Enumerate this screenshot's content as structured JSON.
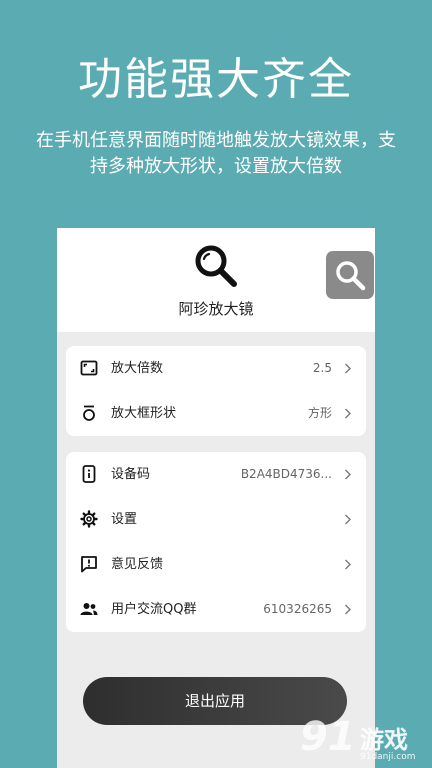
{
  "promo": {
    "title": "功能强大齐全",
    "subtitle": "在手机任意界面随时随地触发放大镜效果，支持多种放大形状，设置放大倍数"
  },
  "app": {
    "name": "阿珍放大镜",
    "logo_icon": "magnifier-icon",
    "float_icon": "magnifier-icon"
  },
  "settings_group1": [
    {
      "label": "放大倍数",
      "value": "2.5",
      "icon": "frame-icon"
    },
    {
      "label": "放大框形状",
      "value": "方形",
      "icon": "shape-icon"
    }
  ],
  "settings_group2": [
    {
      "label": "设备码",
      "value": "B2A4BD4736...",
      "icon": "device-icon"
    },
    {
      "label": "设置",
      "value": "",
      "icon": "gear-icon"
    },
    {
      "label": "意见反馈",
      "value": "",
      "icon": "feedback-icon"
    },
    {
      "label": "用户交流QQ群",
      "value": "610326265",
      "icon": "group-icon"
    }
  ],
  "logout_label": "退出应用",
  "watermark": {
    "number": "91",
    "text": "游戏",
    "url": "91danji.com"
  },
  "colors": {
    "background": "#5aacb2",
    "button": "#3a3a3a",
    "card": "#ffffff"
  }
}
